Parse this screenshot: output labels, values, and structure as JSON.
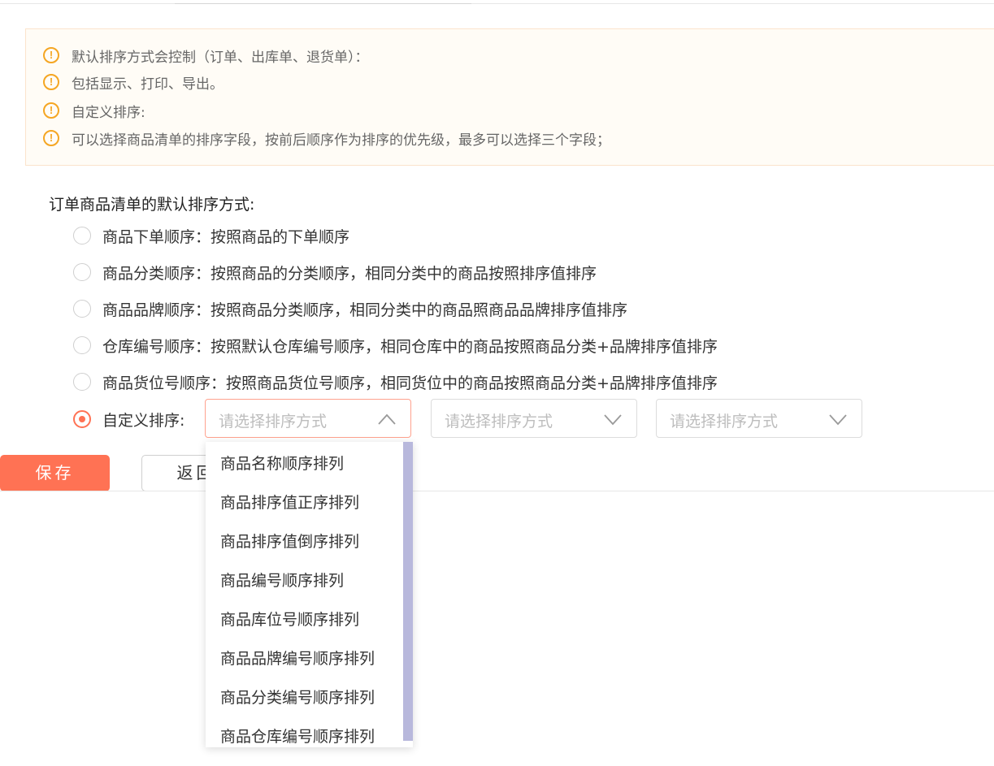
{
  "notices": [
    "默认排序方式会控制（订单、出库单、退货单）：",
    "包括显示、打印、导出。",
    "自定义排序:",
    "可以选择商品清单的排序字段，按前后顺序作为排序的优先级，最多可以选择三个字段；"
  ],
  "section_title": "订单商品清单的默认排序方式:",
  "options": [
    {
      "label": "商品下单顺序：按照商品的下单顺序",
      "checked": false
    },
    {
      "label": "商品分类顺序：按照商品的分类顺序，相同分类中的商品按照排序值排序",
      "checked": false
    },
    {
      "label": "商品品牌顺序：按照商品分类顺序，相同分类中的商品照商品品牌排序值排序",
      "checked": false
    },
    {
      "label": "仓库编号顺序：按照默认仓库编号顺序，相同仓库中的商品按照商品分类+品牌排序值排序",
      "checked": false
    },
    {
      "label": "商品货位号顺序：按照商品货位号顺序，相同货位中的商品按照商品分类+品牌排序值排序",
      "checked": false
    },
    {
      "label": "自定义排序:",
      "checked": true
    }
  ],
  "selects": [
    {
      "placeholder": "请选择排序方式",
      "open": true
    },
    {
      "placeholder": "请选择排序方式",
      "open": false
    },
    {
      "placeholder": "请选择排序方式",
      "open": false
    }
  ],
  "dropdown_options": [
    "商品名称顺序排列",
    "商品排序值正序排列",
    "商品排序值倒序排列",
    "商品编号顺序排列",
    "商品库位号顺序排列",
    "商品品牌编号顺序排列",
    "商品分类编号顺序排列",
    "商品仓库编号顺序排列"
  ],
  "buttons": {
    "save": "保存",
    "back": "返回"
  },
  "colors": {
    "accent": "#ff7254",
    "warning": "#f5a623",
    "scrollbar": "#b8b8dc"
  }
}
